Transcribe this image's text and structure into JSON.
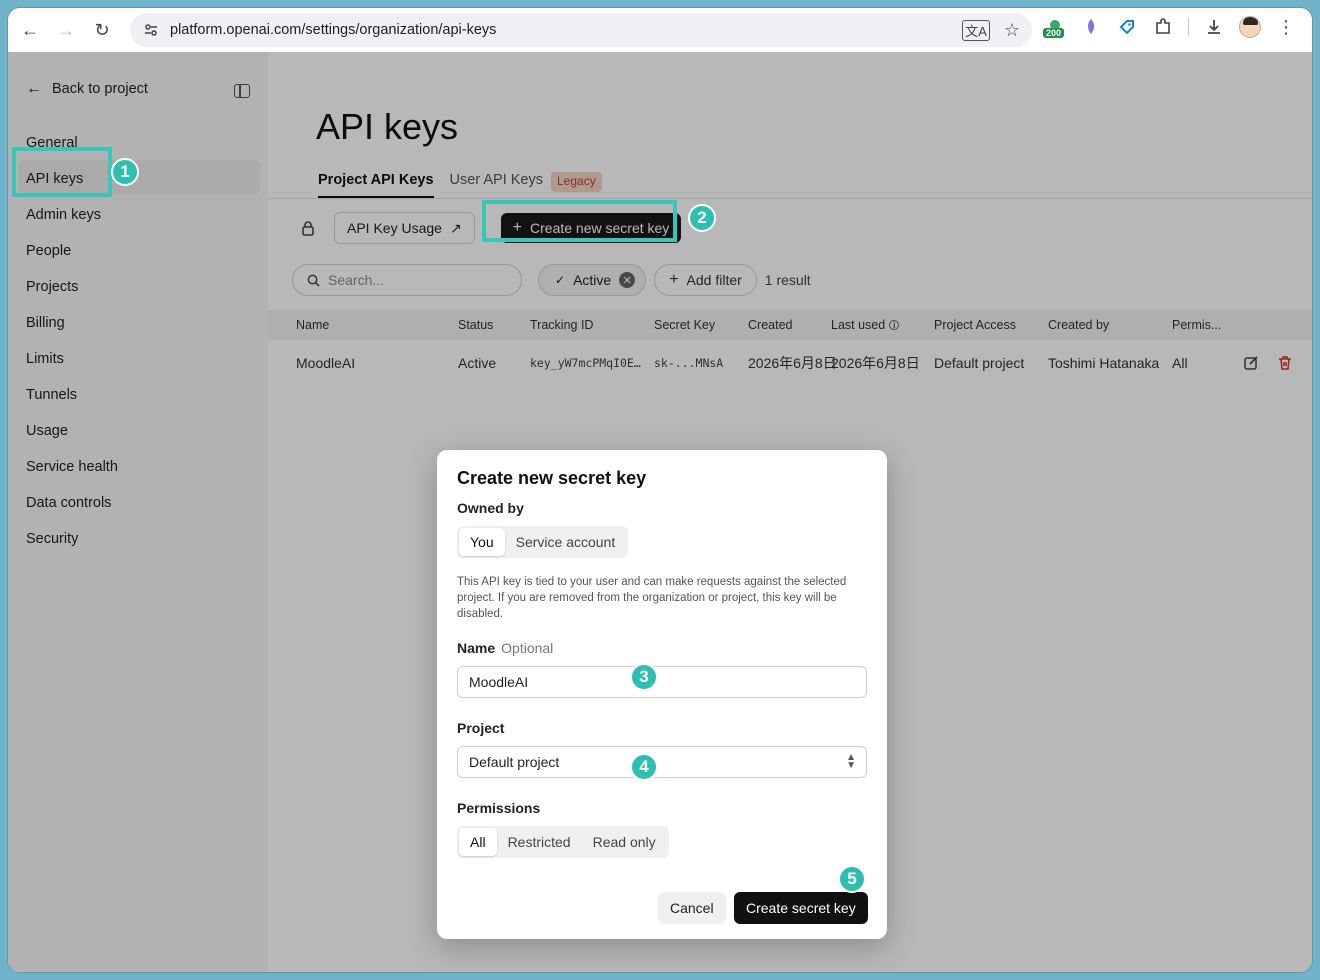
{
  "browser": {
    "url": "platform.openai.com/settings/organization/api-keys",
    "extension_badge": "200"
  },
  "sidebar": {
    "back_label": "Back to project",
    "items": [
      {
        "label": "General"
      },
      {
        "label": "API keys"
      },
      {
        "label": "Admin keys"
      },
      {
        "label": "People"
      },
      {
        "label": "Projects"
      },
      {
        "label": "Billing"
      },
      {
        "label": "Limits"
      },
      {
        "label": "Tunnels"
      },
      {
        "label": "Usage"
      },
      {
        "label": "Service health"
      },
      {
        "label": "Data controls"
      },
      {
        "label": "Security"
      }
    ]
  },
  "main": {
    "title": "API keys",
    "tabs": [
      {
        "label": "Project API Keys"
      },
      {
        "label": "User API Keys"
      }
    ],
    "legacy_badge": "Legacy",
    "usage_button": "API Key Usage",
    "create_button": "Create new secret key",
    "search_placeholder": "Search...",
    "active_filter": "Active",
    "add_filter": "Add filter",
    "result_count": "1 result"
  },
  "table": {
    "headers": [
      "Name",
      "Status",
      "Tracking ID",
      "Secret Key",
      "Created",
      "Last used",
      "Project Access",
      "Created by",
      "Permis..."
    ],
    "rows": [
      {
        "name": "MoodleAI",
        "status": "Active",
        "tracking_id": "key_yW7mcPMqI0E…",
        "secret_key": "sk-...MNsA",
        "created": "2026年6月8日",
        "last_used": "2026年6月8日",
        "project_access": "Default project",
        "created_by": "Toshimi Hatanaka",
        "permissions": "All"
      }
    ]
  },
  "modal": {
    "title": "Create new secret key",
    "owned_by_label": "Owned by",
    "owned_by_options": [
      "You",
      "Service account"
    ],
    "owned_by_selected": "You",
    "description": "This API key is tied to your user and can make requests against the selected project. If you are removed from the organization or project, this key will be disabled.",
    "name_label": "Name",
    "name_optional": "Optional",
    "name_value": "MoodleAI",
    "project_label": "Project",
    "project_value": "Default project",
    "permissions_label": "Permissions",
    "permissions_options": [
      "All",
      "Restricted",
      "Read only"
    ],
    "permissions_selected": "All",
    "cancel_label": "Cancel",
    "create_label": "Create secret key"
  },
  "annotations": {
    "step1": "1",
    "step2": "2",
    "step3": "3",
    "step4": "4",
    "step5": "5",
    "color": "#36c7b9"
  }
}
